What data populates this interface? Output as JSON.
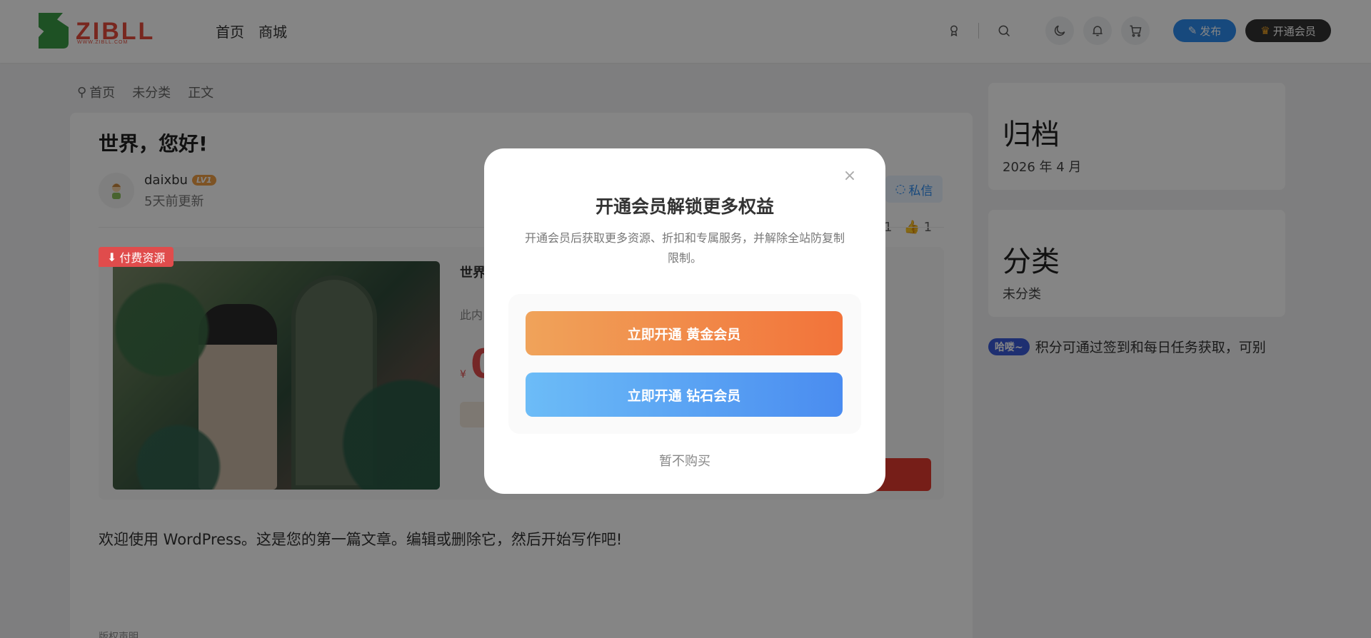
{
  "header": {
    "logo_text": "ZIBLL",
    "logo_sub": "WWW.ZIBLL.COM",
    "nav": [
      {
        "label": "首页"
      },
      {
        "label": "商城"
      }
    ],
    "publish_label": "发布",
    "vip_label": "开通会员"
  },
  "breadcrumb": {
    "items": [
      "首页",
      "未分类",
      "正文"
    ]
  },
  "post": {
    "title": "世界，您好!",
    "author": "daixbu",
    "level": "LV1",
    "updated": "5天前更新",
    "pm_label": "私信",
    "stat_comments": "1",
    "stat_likes": "1",
    "paid_tag": "付费资源",
    "resource_title": "世界",
    "resource_desc": "此内",
    "price_symbol": "¥",
    "price_value": "0",
    "content": "欢迎使用 WordPress。这是您的第一篇文章。编辑或删除它，然后开始写作吧!",
    "copyright": "版权声明"
  },
  "sidebar": {
    "archive_title": "归档",
    "archive_item": "2026 年 4 月",
    "category_title": "分类",
    "category_item": "未分类",
    "notice_tag": "哈喽~",
    "notice_text": "积分可通过签到和每日任务获取，可别"
  },
  "modal": {
    "title": "开通会员解锁更多权益",
    "desc": "开通会员后获取更多资源、折扣和专属服务，并解除全站防复制限制。",
    "gold_label": "立即开通 黄金会员",
    "diamond_label": "立即开通 钻石会员",
    "no_buy_label": "暂不购买",
    "close_icon": "×"
  },
  "colors": {
    "brand_red": "#e74c3c",
    "brand_green": "#3a9b46",
    "publish_blue": "#2d8cf0",
    "gold_start": "#f0a35a",
    "gold_end": "#f2733a",
    "diamond_start": "#6cbcf7",
    "diamond_end": "#4a8cf0"
  }
}
